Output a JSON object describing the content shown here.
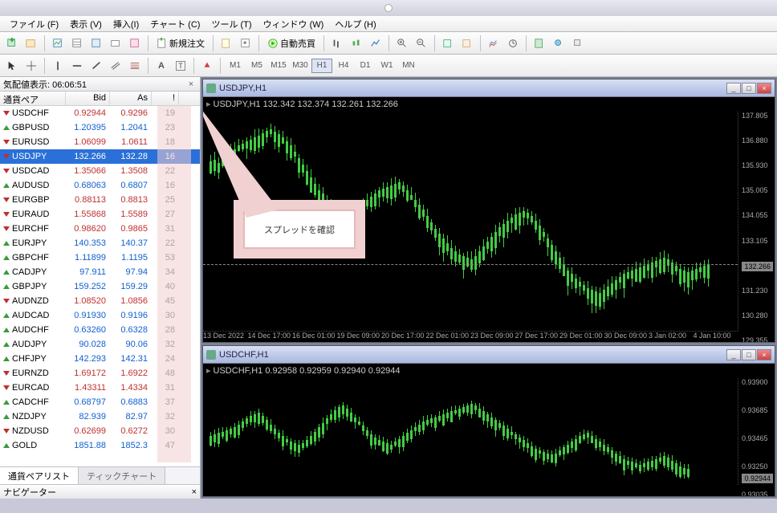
{
  "menu": {
    "file": "ファイル (F)",
    "view": "表示 (V)",
    "insert": "挿入(I)",
    "chart": "チャート (C)",
    "tool": "ツール (T)",
    "window": "ウィンドウ (W)",
    "help": "ヘルプ (H)"
  },
  "toolbar": {
    "new_order": "新規注文",
    "auto_trade": "自動売買"
  },
  "timeframes": [
    "M1",
    "M5",
    "M15",
    "M30",
    "H1",
    "H4",
    "D1",
    "W1",
    "MN"
  ],
  "timeframe_active": "H1",
  "marketwatch": {
    "title": "気配値表示: 06:06:51",
    "col_symbol": "通貨ペア",
    "col_bid": "Bid",
    "col_ask": "As",
    "col_spread": "!",
    "rows": [
      {
        "sym": "USDCHF",
        "bid": "0.92944",
        "ask": "0.9296",
        "sp": "19",
        "dir": "down"
      },
      {
        "sym": "GBPUSD",
        "bid": "1.20395",
        "ask": "1.2041",
        "sp": "23",
        "dir": "up"
      },
      {
        "sym": "EURUSD",
        "bid": "1.06099",
        "ask": "1.0611",
        "sp": "18",
        "dir": "down"
      },
      {
        "sym": "USDJPY",
        "bid": "132.266",
        "ask": "132.28",
        "sp": "16",
        "dir": "down",
        "selected": true
      },
      {
        "sym": "USDCAD",
        "bid": "1.35066",
        "ask": "1.3508",
        "sp": "22",
        "dir": "down"
      },
      {
        "sym": "AUDUSD",
        "bid": "0.68063",
        "ask": "0.6807",
        "sp": "16",
        "dir": "up"
      },
      {
        "sym": "EURGBP",
        "bid": "0.88113",
        "ask": "0.8813",
        "sp": "25",
        "dir": "down"
      },
      {
        "sym": "EURAUD",
        "bid": "1.55868",
        "ask": "1.5589",
        "sp": "27",
        "dir": "down"
      },
      {
        "sym": "EURCHF",
        "bid": "0.98620",
        "ask": "0.9865",
        "sp": "31",
        "dir": "down"
      },
      {
        "sym": "EURJPY",
        "bid": "140.353",
        "ask": "140.37",
        "sp": "22",
        "dir": "up"
      },
      {
        "sym": "GBPCHF",
        "bid": "1.11899",
        "ask": "1.1195",
        "sp": "53",
        "dir": "up"
      },
      {
        "sym": "CADJPY",
        "bid": "97.911",
        "ask": "97.94",
        "sp": "34",
        "dir": "up"
      },
      {
        "sym": "GBPJPY",
        "bid": "159.252",
        "ask": "159.29",
        "sp": "40",
        "dir": "up"
      },
      {
        "sym": "AUDNZD",
        "bid": "1.08520",
        "ask": "1.0856",
        "sp": "45",
        "dir": "down"
      },
      {
        "sym": "AUDCAD",
        "bid": "0.91930",
        "ask": "0.9196",
        "sp": "30",
        "dir": "up"
      },
      {
        "sym": "AUDCHF",
        "bid": "0.63260",
        "ask": "0.6328",
        "sp": "28",
        "dir": "up"
      },
      {
        "sym": "AUDJPY",
        "bid": "90.028",
        "ask": "90.06",
        "sp": "32",
        "dir": "up"
      },
      {
        "sym": "CHFJPY",
        "bid": "142.293",
        "ask": "142.31",
        "sp": "24",
        "dir": "up"
      },
      {
        "sym": "EURNZD",
        "bid": "1.69172",
        "ask": "1.6922",
        "sp": "48",
        "dir": "down"
      },
      {
        "sym": "EURCAD",
        "bid": "1.43311",
        "ask": "1.4334",
        "sp": "31",
        "dir": "down"
      },
      {
        "sym": "CADCHF",
        "bid": "0.68797",
        "ask": "0.6883",
        "sp": "37",
        "dir": "up"
      },
      {
        "sym": "NZDJPY",
        "bid": "82.939",
        "ask": "82.97",
        "sp": "32",
        "dir": "up"
      },
      {
        "sym": "NZDUSD",
        "bid": "0.62699",
        "ask": "0.6272",
        "sp": "30",
        "dir": "down"
      },
      {
        "sym": "GOLD",
        "bid": "1851.88",
        "ask": "1852.3",
        "sp": "47",
        "dir": "up"
      }
    ],
    "tab_list": "通貨ペアリスト",
    "tab_tick": "ティックチャート"
  },
  "navigator": {
    "title": "ナビゲーター"
  },
  "chart1": {
    "title": "USDJPY,H1",
    "info": "USDJPY,H1  132.342 132.374 132.261 132.266",
    "y_ticks": [
      "137.805",
      "136.880",
      "135.930",
      "135.005",
      "134.055",
      "133.105",
      "132.266",
      "131.230",
      "130.280",
      "129.355"
    ],
    "y_current": "132.266",
    "x_ticks": [
      "13 Dec 2022",
      "14 Dec 17:00",
      "16 Dec 01:00",
      "19 Dec 09:00",
      "20 Dec 17:00",
      "22 Dec 01:00",
      "23 Dec 09:00",
      "27 Dec 17:00",
      "29 Dec 01:00",
      "30 Dec 09:00",
      "3 Jan 02:00",
      "4 Jan 10:00"
    ]
  },
  "chart2": {
    "title": "USDCHF,H1",
    "info": "USDCHF,H1  0.92958 0.92959 0.92940 0.92944",
    "y_ticks": [
      "0.93900",
      "0.93685",
      "0.93465",
      "0.93250",
      "0.93035"
    ],
    "y_current": "0.92944"
  },
  "callout": {
    "text": "スプレッドを確認"
  }
}
